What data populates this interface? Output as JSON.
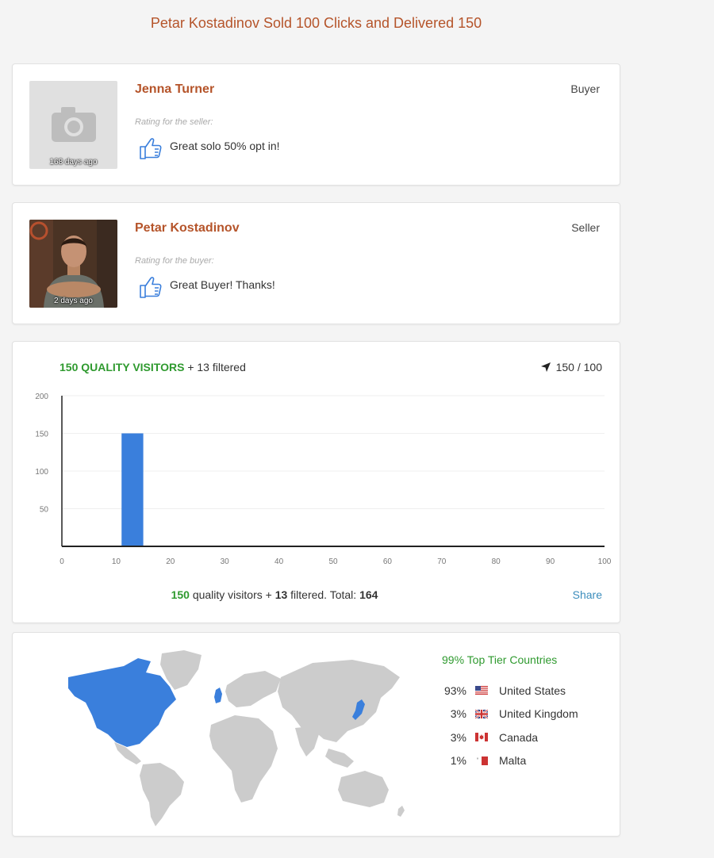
{
  "header": {
    "title": "Petar Kostadinov Sold 100 Clicks and Delivered 150"
  },
  "reviews": [
    {
      "name": "Jenna Turner",
      "role": "Buyer",
      "time": "168 days ago",
      "rating_label": "Rating for the seller:",
      "text": "Great solo 50% opt in!",
      "avatar": "camera-icon"
    },
    {
      "name": "Petar Kostadinov",
      "role": "Seller",
      "time": "2 days ago",
      "rating_label": "Rating for the buyer:",
      "text": "Great Buyer! Thanks!",
      "avatar": "photo"
    }
  ],
  "chart_section": {
    "headline_quality": "150 QUALITY VISITORS",
    "headline_filtered": "+ 13 filtered",
    "delivery_ratio": "150 / 100",
    "summary": {
      "quality_count": "150",
      "quality_label": "quality visitors +",
      "filtered_count": "13",
      "filtered_label": "filtered. Total:",
      "total": "164"
    },
    "share_label": "Share"
  },
  "chart_data": {
    "type": "bar",
    "x": [
      11
    ],
    "values": [
      150
    ],
    "bar_width": 4,
    "xlim": [
      0,
      100
    ],
    "ylim": [
      0,
      200
    ],
    "xticks": [
      0,
      10,
      20,
      30,
      40,
      50,
      60,
      70,
      80,
      90,
      100
    ],
    "yticks": [
      50,
      100,
      150,
      200
    ],
    "grid": true,
    "bar_color": "#3a7fdc"
  },
  "geo": {
    "tier_title": "99% Top Tier Countries",
    "highlight_color": "#3a7fdc",
    "base_color": "#cccccc",
    "countries": [
      {
        "pct": "93%",
        "name": "United States",
        "flag": "us-flag"
      },
      {
        "pct": "3%",
        "name": "United Kingdom",
        "flag": "uk-flag"
      },
      {
        "pct": "3%",
        "name": "Canada",
        "flag": "ca-flag"
      },
      {
        "pct": "1%",
        "name": "Malta",
        "flag": "mt-flag"
      }
    ]
  }
}
